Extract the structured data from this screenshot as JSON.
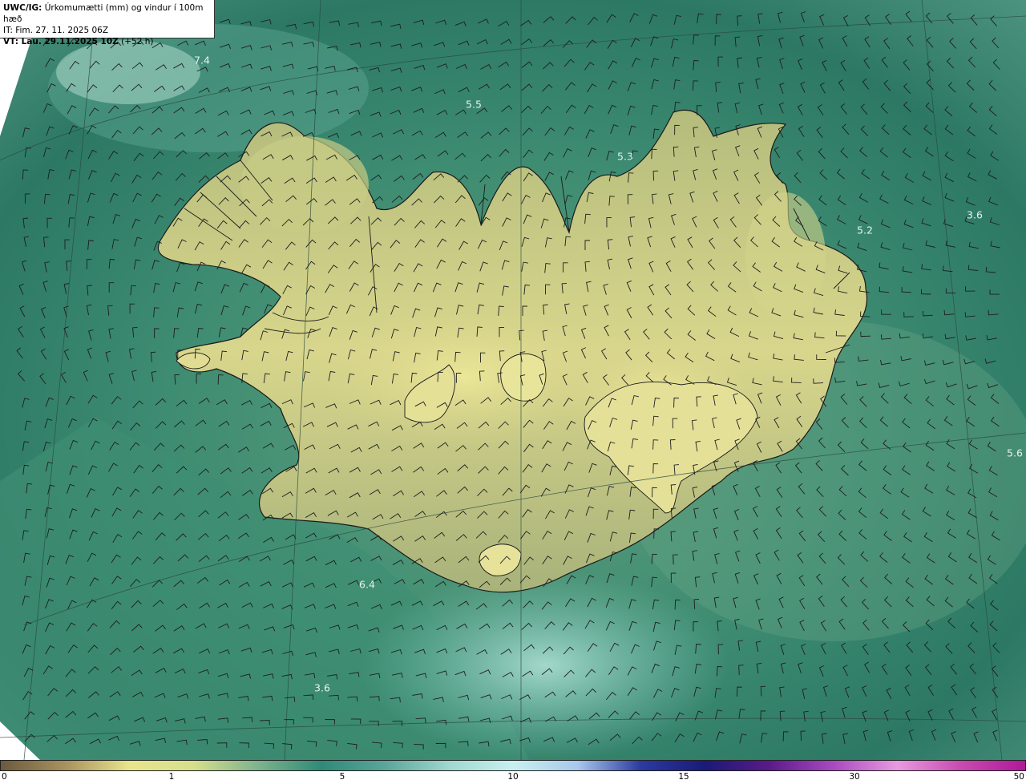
{
  "header": {
    "model": "UWC/IG:",
    "title": "Úrkomumætti (mm) og vindur í 100m hæð",
    "it_line": "IT: Fim. 27. 11. 2025 06Z",
    "vt_bold": "VT: Lau. 29.11.2025 10Z",
    "vt_lead": "(+52 h)"
  },
  "map_labels": [
    {
      "text": "7.4"
    },
    {
      "text": "5.5"
    },
    {
      "text": "5.3"
    },
    {
      "text": "3.6"
    },
    {
      "text": "5.2"
    },
    {
      "text": "5.6"
    },
    {
      "text": "6.4"
    },
    {
      "text": "3.6"
    }
  ],
  "colorbar": {
    "ticks": [
      "0",
      "1",
      "5",
      "10",
      "15",
      "30",
      "50"
    ],
    "colors": [
      "#6b5a3e",
      "#a8925e",
      "#e8e48c",
      "#d6e08c",
      "#7fb48e",
      "#2f8a78",
      "#5aa69a",
      "#9fd8d0",
      "#c8f0f0",
      "#a8c8ec",
      "#2a3aa0",
      "#1a1a78",
      "#5a1a8a",
      "#a84ac0",
      "#e89ae0",
      "#c84ab0",
      "#b0189a"
    ]
  },
  "colors": {
    "ocean_dark": "#2e7a6a",
    "ocean_mid": "#4f9a86",
    "land_low": "#a6b276",
    "land_high": "#e2df92"
  }
}
